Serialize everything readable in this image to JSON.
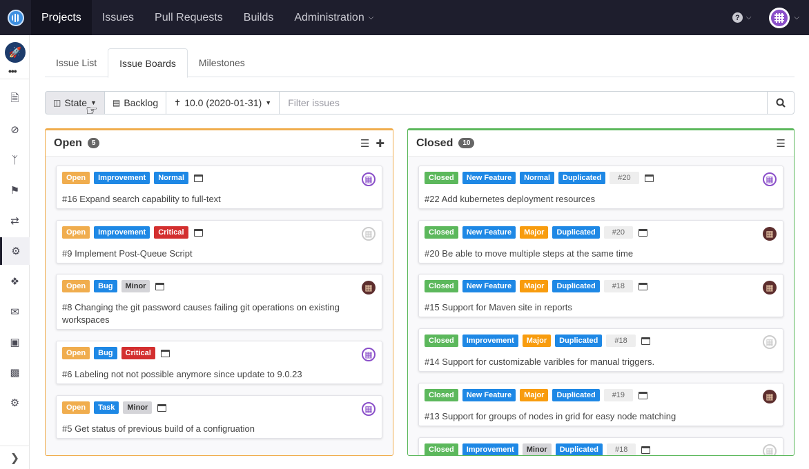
{
  "topnav": {
    "items": [
      {
        "label": "Projects"
      },
      {
        "label": "Issues"
      },
      {
        "label": "Pull Requests"
      },
      {
        "label": "Builds"
      },
      {
        "label": "Administration"
      }
    ],
    "help_icon": "question-circle-icon"
  },
  "tabs": [
    {
      "label": "Issue List"
    },
    {
      "label": "Issue Boards"
    },
    {
      "label": "Milestones"
    }
  ],
  "toolbar": {
    "state_label": "State",
    "backlog_label": "Backlog",
    "milestone_label": "10.0 (2020-01-31)",
    "search_placeholder": "Filter issues"
  },
  "columns": {
    "open": {
      "title": "Open",
      "count": "5",
      "cards": [
        {
          "badges": [
            "Open",
            "Improvement",
            "Normal"
          ],
          "title": "#16 Expand search capability to full-text"
        },
        {
          "badges": [
            "Open",
            "Improvement",
            "Critical"
          ],
          "title": "#9 Implement Post-Queue Script"
        },
        {
          "badges": [
            "Open",
            "Bug",
            "Minor"
          ],
          "title": "#8 Changing the git password causes failing git operations on existing workspaces"
        },
        {
          "badges": [
            "Open",
            "Bug",
            "Critical"
          ],
          "title": "#6 Labeling not not possible anymore since update to 9.0.23"
        },
        {
          "badges": [
            "Open",
            "Task",
            "Minor"
          ],
          "title": "#5 Get status of previous build of a configruation"
        }
      ]
    },
    "closed": {
      "title": "Closed",
      "count": "10",
      "cards": [
        {
          "badges": [
            "Closed",
            "New Feature",
            "Normal",
            "Duplicated",
            "#20"
          ],
          "title": "#22 Add kubernetes deployment resources"
        },
        {
          "badges": [
            "Closed",
            "New Feature",
            "Major",
            "Duplicated",
            "#20"
          ],
          "title": "#20 Be able to move multiple steps at the same time"
        },
        {
          "badges": [
            "Closed",
            "New Feature",
            "Major",
            "Duplicated",
            "#18"
          ],
          "title": "#15 Support for Maven site in reports"
        },
        {
          "badges": [
            "Closed",
            "Improvement",
            "Major",
            "Duplicated",
            "#18"
          ],
          "title": "#14 Support for customizable varibles for manual triggers."
        },
        {
          "badges": [
            "Closed",
            "New Feature",
            "Major",
            "Duplicated",
            "#19"
          ],
          "title": "#13 Support for groups of nodes in grid for easy node matching"
        },
        {
          "badges": [
            "Closed",
            "Improvement",
            "Minor",
            "Duplicated",
            "#18"
          ],
          "title": ""
        }
      ]
    }
  }
}
